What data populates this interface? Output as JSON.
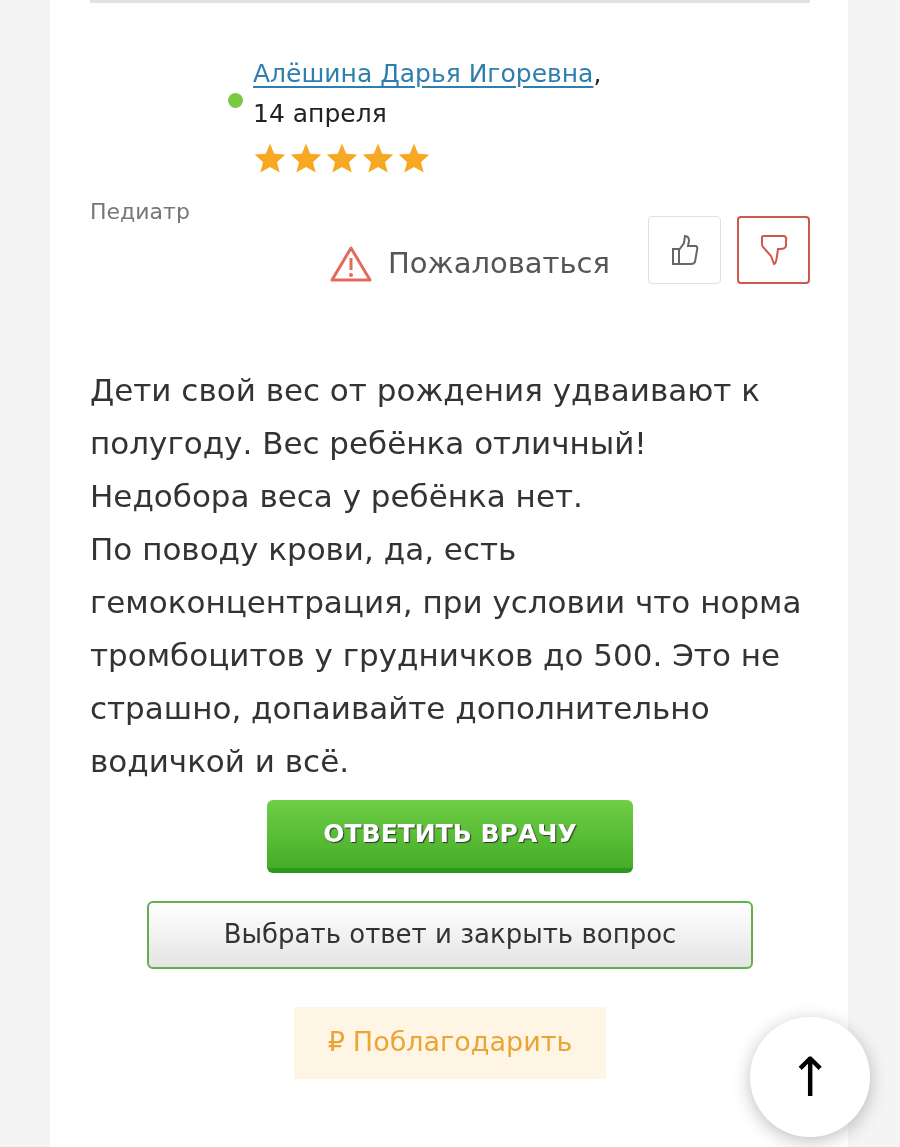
{
  "answer": {
    "author": "Алёшина Дарья Игоревна",
    "comma": ",",
    "date": "14 апреля",
    "online": true,
    "stars": 5,
    "specialty": "Педиатр",
    "complaint": "Пожаловаться",
    "votes": [
      {
        "kind": "like"
      },
      {
        "kind": "dislike"
      }
    ],
    "text": "Дети свой вес от рождения удваивают к полугоду. Вес ребёнка отличный!\nНедобора веса у ребёнка нет.\nПо поводу крови, да, есть гемоконцентрация, при условии что норма тромбоцитов у грудничков до 500. Это не страшно, допаивайте дополнительно водичкой и всё.",
    "reply_button": "ОТВЕТИТЬ ВРАЧУ",
    "choose_button": "Выбрать ответ и закрыть вопрос",
    "thank_button": {
      "symbol": "₽",
      "label": "Поблагодарить"
    }
  },
  "scroll_top": {
    "symbol": "↑"
  }
}
